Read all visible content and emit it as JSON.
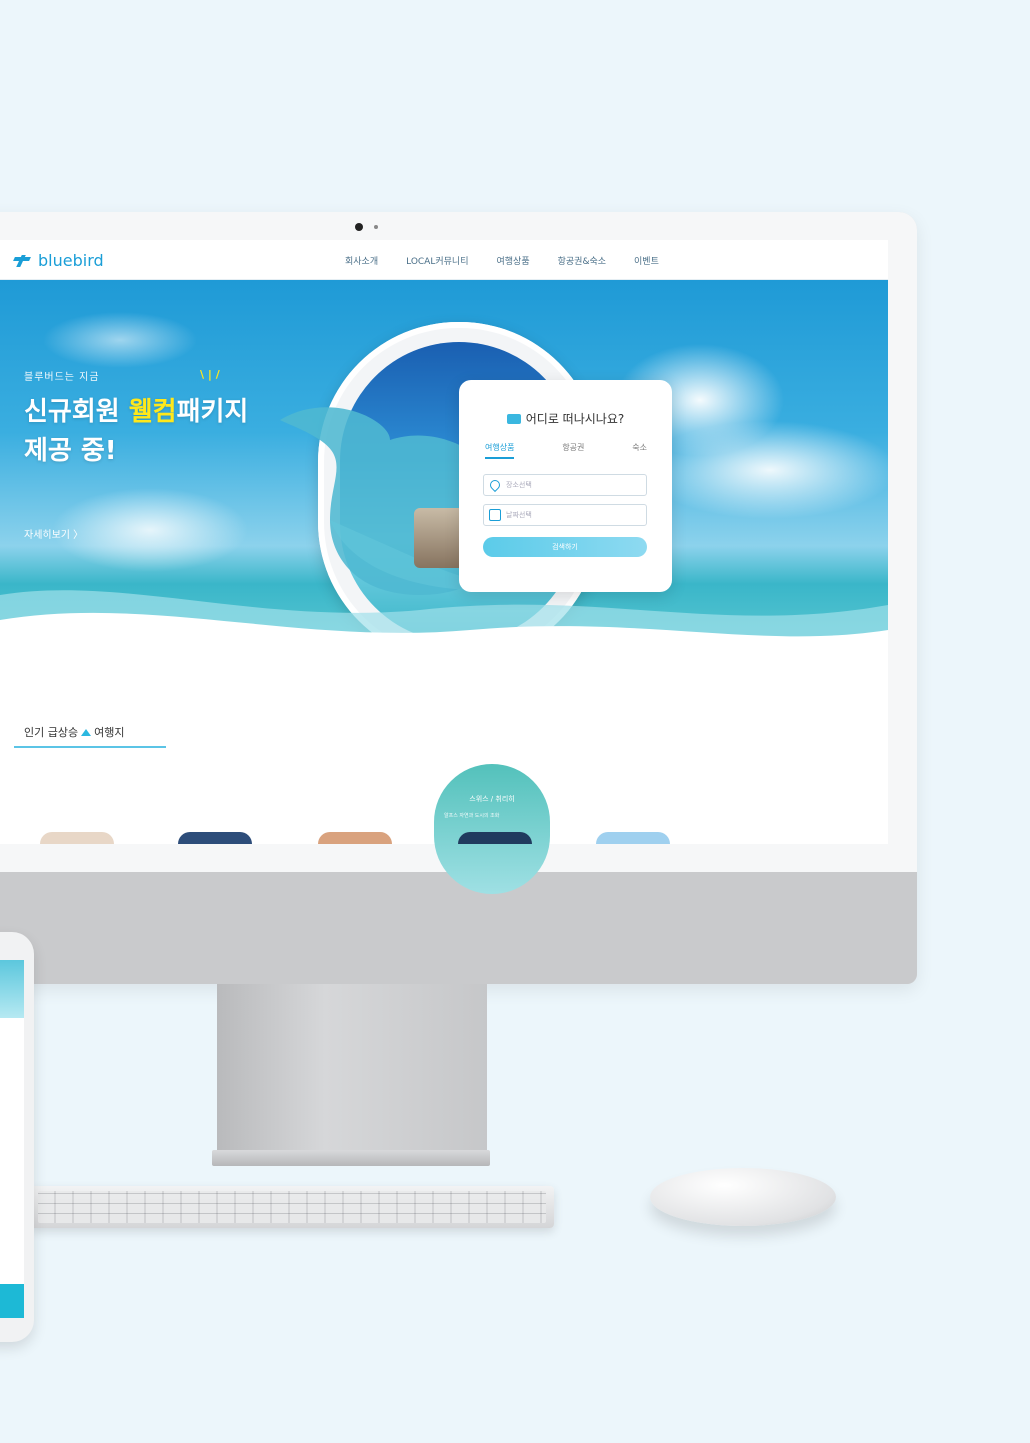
{
  "site": {
    "logo_text": "bluebird",
    "nav": [
      "회사소개",
      "LOCAL커뮤니티",
      "여행상품",
      "항공권&숙소",
      "이벤트"
    ]
  },
  "hero": {
    "subtitle": "블루버드는 지금",
    "title_part1": "신규회원 ",
    "title_highlight": "웰컴",
    "title_part2": "패키지",
    "title_line2": "제공 중!",
    "more_link": "자세히보기 〉"
  },
  "search_card": {
    "title": "어디로 떠나시나요?",
    "tabs": [
      "여행상품",
      "항공권",
      "숙소"
    ],
    "place_placeholder": "장소선택",
    "date_placeholder": "날짜선택",
    "button": "검색하기"
  },
  "popular": {
    "title_part1": "인기 급상승",
    "title_part2": "여행지",
    "feature_title": "스위스 / 취리히",
    "feature_sub": "알프스 자연과 도시의 조화"
  },
  "colors": {
    "brand": "#1a9ed7",
    "highlight": "#ffe81a",
    "background": "#ecf6fb"
  },
  "icons": [
    "bird-logo-icon",
    "suitcase-icon",
    "location-pin-icon",
    "calendar-icon",
    "arrow-up-icon"
  ]
}
